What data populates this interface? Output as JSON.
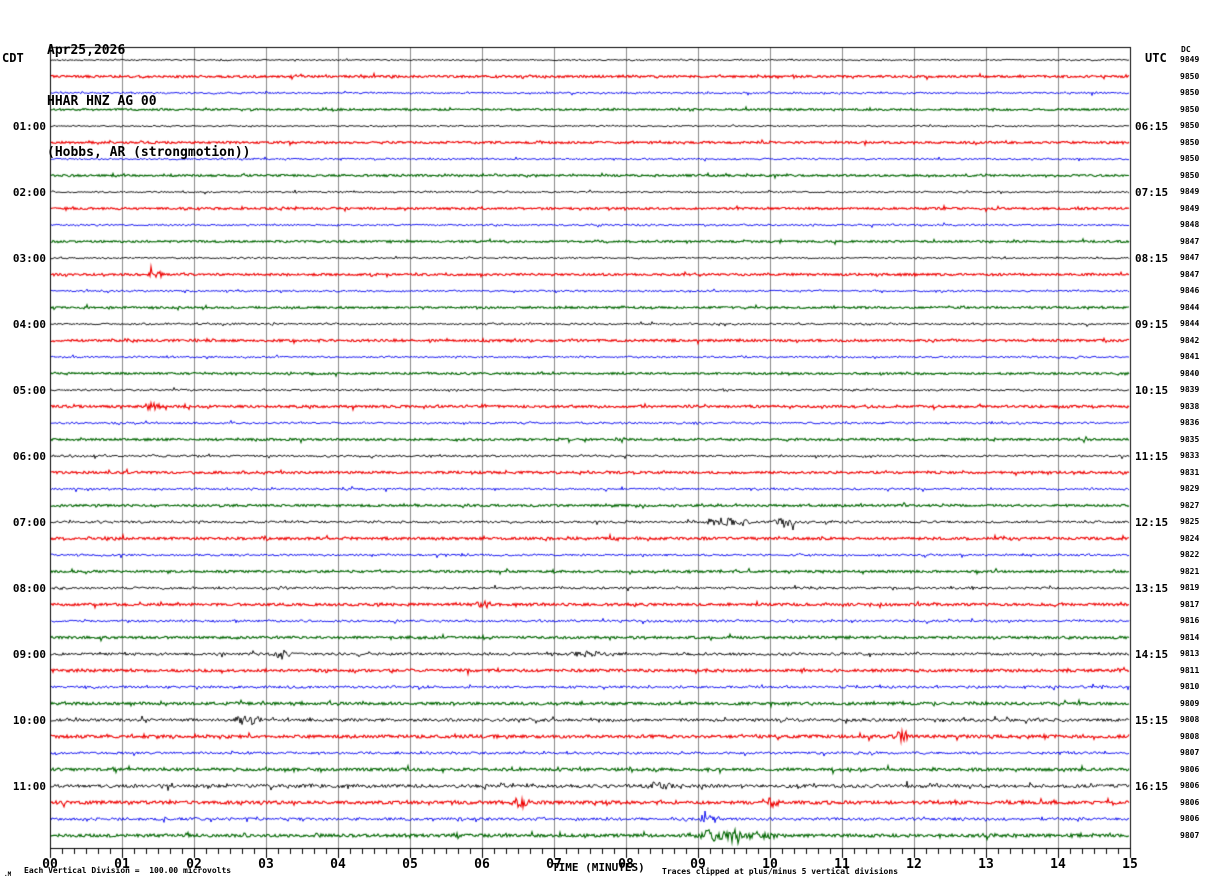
{
  "header": {
    "date": "Apr25,2026",
    "station": "HHAR HNZ AG 00",
    "location": "(Hobbs, AR (strongmotion))"
  },
  "axis_headers": {
    "left": "CDT",
    "right": "UTC",
    "dc": "DC"
  },
  "x_axis": {
    "title": "TIME (MINUTES)",
    "tick_labels": [
      "00",
      "01",
      "02",
      "03",
      "04",
      "05",
      "06",
      "07",
      "08",
      "09",
      "10",
      "11",
      "12",
      "13",
      "14",
      "15"
    ]
  },
  "footer": {
    "scale_marker": ".M",
    "scale_note": "Each Vertical Division =  100.00 microvolts",
    "clip_note": "Traces clipped at plus/minus 5 vertical divisions"
  },
  "chart_data": {
    "type": "line",
    "subtype": "helicorder-seismogram",
    "title": "HHAR HNZ AG 00 (Hobbs, AR (strongmotion)) Apr25,2026",
    "xlabel": "TIME (MINUTES)",
    "x_range": [
      0,
      15
    ],
    "minutes_per_line": 15,
    "minor_ticks_per_minute": 6,
    "grid": true,
    "grid_color": "#888888",
    "frame_color": "#000000",
    "trace_colors": [
      "#000000",
      "#ee0000",
      "#0000ee",
      "#006600"
    ],
    "rows": [
      {
        "cdt": "",
        "utc": "",
        "dc": "9849",
        "amp": 0.7
      },
      {
        "cdt": "",
        "utc": "",
        "dc": "9850",
        "amp": 1.1
      },
      {
        "cdt": "",
        "utc": "",
        "dc": "9850",
        "amp": 0.9
      },
      {
        "cdt": "",
        "utc": "",
        "dc": "9850",
        "amp": 1.0
      },
      {
        "cdt": "01:00",
        "utc": "06:15",
        "dc": "9850",
        "amp": 0.7
      },
      {
        "cdt": "",
        "utc": "",
        "dc": "9850",
        "amp": 1.1
      },
      {
        "cdt": "",
        "utc": "",
        "dc": "9850",
        "amp": 0.9
      },
      {
        "cdt": "",
        "utc": "",
        "dc": "9850",
        "amp": 1.0
      },
      {
        "cdt": "02:00",
        "utc": "07:15",
        "dc": "9849",
        "amp": 0.8
      },
      {
        "cdt": "",
        "utc": "",
        "dc": "9849",
        "amp": 1.1
      },
      {
        "cdt": "",
        "utc": "",
        "dc": "9848",
        "amp": 0.9
      },
      {
        "cdt": "",
        "utc": "",
        "dc": "9847",
        "amp": 1.0
      },
      {
        "cdt": "03:00",
        "utc": "08:15",
        "dc": "9847",
        "amp": 0.8
      },
      {
        "cdt": "",
        "utc": "",
        "dc": "9847",
        "amp": 1.1
      },
      {
        "cdt": "",
        "utc": "",
        "dc": "9846",
        "amp": 0.9
      },
      {
        "cdt": "",
        "utc": "",
        "dc": "9844",
        "amp": 1.0
      },
      {
        "cdt": "04:00",
        "utc": "09:15",
        "dc": "9844",
        "amp": 0.9
      },
      {
        "cdt": "",
        "utc": "",
        "dc": "9842",
        "amp": 1.2
      },
      {
        "cdt": "",
        "utc": "",
        "dc": "9841",
        "amp": 0.9
      },
      {
        "cdt": "",
        "utc": "",
        "dc": "9840",
        "amp": 1.0
      },
      {
        "cdt": "05:00",
        "utc": "10:15",
        "dc": "9839",
        "amp": 0.9
      },
      {
        "cdt": "",
        "utc": "",
        "dc": "9838",
        "amp": 1.2
      },
      {
        "cdt": "",
        "utc": "",
        "dc": "9836",
        "amp": 1.0
      },
      {
        "cdt": "",
        "utc": "",
        "dc": "9835",
        "amp": 1.1
      },
      {
        "cdt": "06:00",
        "utc": "11:15",
        "dc": "9833",
        "amp": 1.0
      },
      {
        "cdt": "",
        "utc": "",
        "dc": "9831",
        "amp": 1.2
      },
      {
        "cdt": "",
        "utc": "",
        "dc": "9829",
        "amp": 1.0
      },
      {
        "cdt": "",
        "utc": "",
        "dc": "9827",
        "amp": 1.1
      },
      {
        "cdt": "07:00",
        "utc": "12:15",
        "dc": "9825",
        "amp": 1.1
      },
      {
        "cdt": "",
        "utc": "",
        "dc": "9824",
        "amp": 1.3
      },
      {
        "cdt": "",
        "utc": "",
        "dc": "9822",
        "amp": 1.0
      },
      {
        "cdt": "",
        "utc": "",
        "dc": "9821",
        "amp": 1.1
      },
      {
        "cdt": "08:00",
        "utc": "13:15",
        "dc": "9819",
        "amp": 1.1
      },
      {
        "cdt": "",
        "utc": "",
        "dc": "9817",
        "amp": 1.3
      },
      {
        "cdt": "",
        "utc": "",
        "dc": "9816",
        "amp": 1.1
      },
      {
        "cdt": "",
        "utc": "",
        "dc": "9814",
        "amp": 1.2
      },
      {
        "cdt": "09:00",
        "utc": "14:15",
        "dc": "9813",
        "amp": 1.3
      },
      {
        "cdt": "",
        "utc": "",
        "dc": "9811",
        "amp": 1.4
      },
      {
        "cdt": "",
        "utc": "",
        "dc": "9810",
        "amp": 1.2
      },
      {
        "cdt": "",
        "utc": "",
        "dc": "9809",
        "amp": 1.3
      },
      {
        "cdt": "10:00",
        "utc": "15:15",
        "dc": "9808",
        "amp": 1.5
      },
      {
        "cdt": "",
        "utc": "",
        "dc": "9808",
        "amp": 1.5
      },
      {
        "cdt": "",
        "utc": "",
        "dc": "9807",
        "amp": 1.2
      },
      {
        "cdt": "",
        "utc": "",
        "dc": "9806",
        "amp": 1.4
      },
      {
        "cdt": "11:00",
        "utc": "16:15",
        "dc": "9806",
        "amp": 1.7
      },
      {
        "cdt": "",
        "utc": "",
        "dc": "9806",
        "amp": 1.6
      },
      {
        "cdt": "",
        "utc": "",
        "dc": "9806",
        "amp": 1.4
      },
      {
        "cdt": "",
        "utc": "",
        "dc": "9807",
        "amp": 1.5
      }
    ],
    "bursts": [
      {
        "row": 13,
        "m0": 1.35,
        "m1": 1.6,
        "amp": 2.0
      },
      {
        "row": 21,
        "m0": 1.3,
        "m1": 1.55,
        "amp": 2.0
      },
      {
        "row": 28,
        "m0": 9.0,
        "m1": 9.75,
        "amp": 2.2
      },
      {
        "row": 28,
        "m0": 10.05,
        "m1": 10.35,
        "amp": 2.8
      },
      {
        "row": 33,
        "m0": 5.9,
        "m1": 6.15,
        "amp": 2.0
      },
      {
        "row": 36,
        "m0": 3.1,
        "m1": 3.35,
        "amp": 2.8
      },
      {
        "row": 36,
        "m0": 7.2,
        "m1": 7.75,
        "amp": 1.8
      },
      {
        "row": 40,
        "m0": 2.55,
        "m1": 2.95,
        "amp": 3.0
      },
      {
        "row": 41,
        "m0": 11.7,
        "m1": 11.95,
        "amp": 2.8
      },
      {
        "row": 44,
        "m0": 8.2,
        "m1": 8.7,
        "amp": 2.2
      },
      {
        "row": 45,
        "m0": 6.4,
        "m1": 6.65,
        "amp": 2.8
      },
      {
        "row": 45,
        "m0": 9.85,
        "m1": 10.15,
        "amp": 2.4
      },
      {
        "row": 46,
        "m0": 9.0,
        "m1": 9.3,
        "amp": 3.2
      },
      {
        "row": 47,
        "m0": 8.8,
        "m1": 10.3,
        "amp": 2.2
      },
      {
        "row": 47,
        "m0": 9.05,
        "m1": 9.3,
        "amp": 3.4
      }
    ]
  }
}
